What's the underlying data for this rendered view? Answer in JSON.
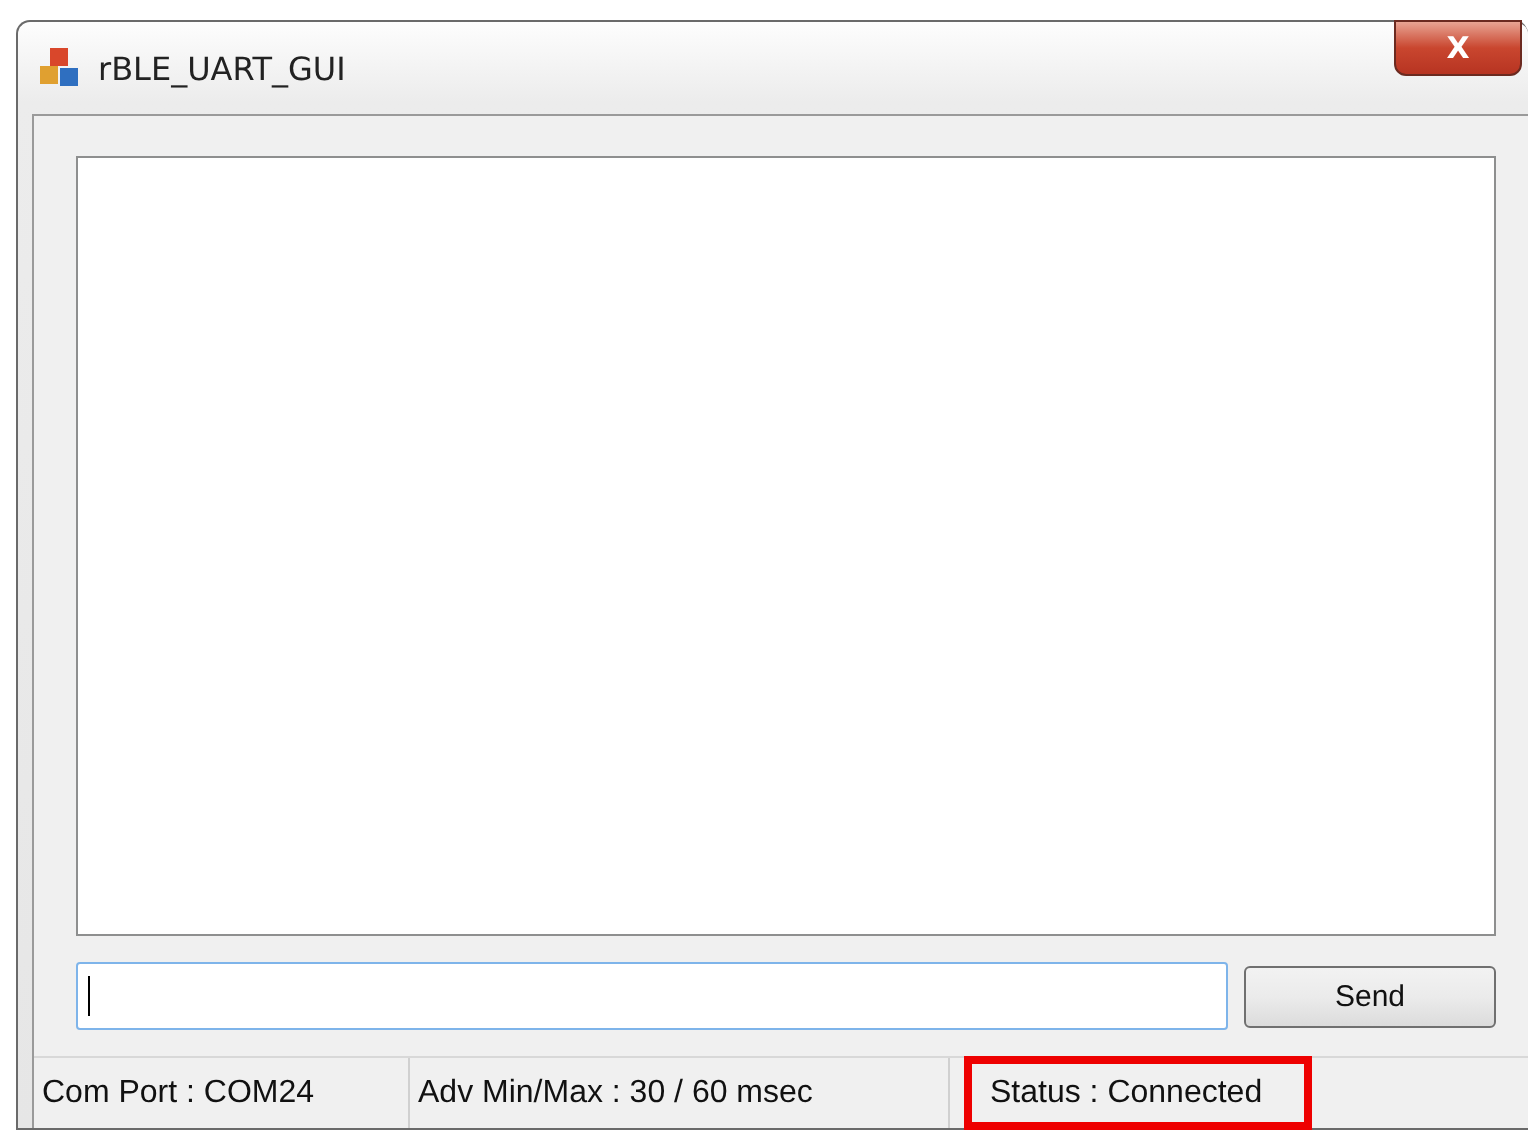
{
  "window": {
    "title": "rBLE_UART_GUI",
    "close": "X"
  },
  "send_button": "Send",
  "status_bar": [
    {
      "text": "Com Port : COM24",
      "highlighted": false
    },
    {
      "text": "Adv Min/Max : 30 / 60 msec",
      "highlighted": false
    },
    {
      "text": "Status : Connected",
      "highlighted": true
    }
  ]
}
